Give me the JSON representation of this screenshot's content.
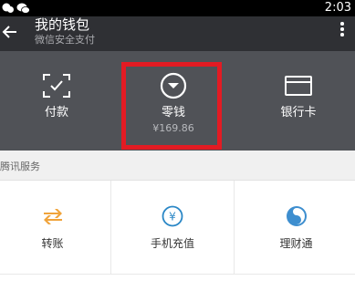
{
  "status_bar": {
    "time": "2:03"
  },
  "header": {
    "title": "我的钱包",
    "subtitle": "微信安全支付"
  },
  "top_actions": [
    {
      "label": "付款",
      "icon": "scan-pay-icon"
    },
    {
      "label": "零钱",
      "amount": "¥169.86",
      "icon": "coin-icon"
    },
    {
      "label": "银行卡",
      "icon": "bank-card-icon"
    }
  ],
  "section": {
    "title": "腾讯服务"
  },
  "services": [
    {
      "label": "转账",
      "icon": "transfer-icon"
    },
    {
      "label": "手机充值",
      "icon": "phone-recharge-icon"
    },
    {
      "label": "理财通",
      "icon": "wealth-icon"
    }
  ],
  "colors": {
    "header_bg": "#2f3034",
    "actions_bg": "#505257",
    "highlight": "#e31b23",
    "transfer": "#f0a33a",
    "recharge": "#2a87c6",
    "wealth": "#3d8ecf"
  }
}
